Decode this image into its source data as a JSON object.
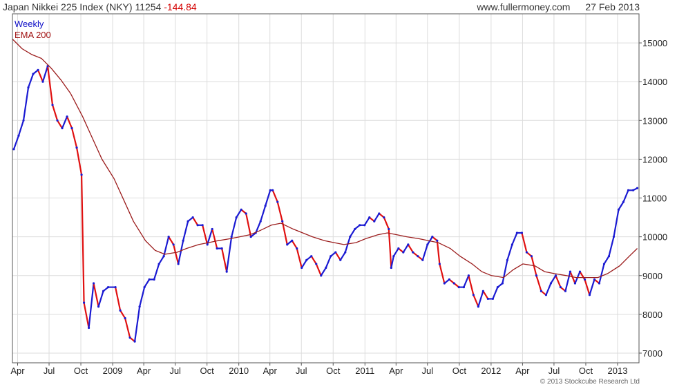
{
  "header": {
    "title": "Japan Nikkei 225 Index (NKY)",
    "last": "11254",
    "change": "-144.84",
    "source": "www.fullermoney.com",
    "date": "27 Feb 2013"
  },
  "footer": "© 2013 Stockcube Research Ltd",
  "colors": {
    "up": "#1a1ad2",
    "down": "#e01010",
    "ema": "#9b1c1c",
    "grid": "#dcdcdc",
    "axis": "#555555"
  },
  "chart_data": {
    "type": "candlestick",
    "title": "Japan Nikkei 225 Index (NKY)",
    "frequency_label": "Weekly",
    "legend": [
      "Weekly",
      "EMA 200"
    ],
    "xlabel": "",
    "ylabel": "",
    "ylim": [
      6750,
      15750
    ],
    "yticks": [
      7000,
      8000,
      9000,
      10000,
      11000,
      12000,
      13000,
      14000,
      15000
    ],
    "x_tick_labels": [
      "Apr",
      "Jul",
      "Oct",
      "2009",
      "Apr",
      "Jul",
      "Oct",
      "2010",
      "Apr",
      "Jul",
      "Oct",
      "2011",
      "Apr",
      "Jul",
      "Oct",
      "2012",
      "Apr",
      "Jul",
      "Oct",
      "2013"
    ],
    "x_tick_dates": [
      "2008-04-01",
      "2008-07-01",
      "2008-10-01",
      "2009-01-01",
      "2009-04-01",
      "2009-07-01",
      "2009-10-01",
      "2010-01-01",
      "2010-04-01",
      "2010-07-01",
      "2010-10-01",
      "2011-01-01",
      "2011-04-01",
      "2011-07-01",
      "2011-10-01",
      "2012-01-01",
      "2012-04-01",
      "2012-07-01",
      "2012-10-01",
      "2013-01-01"
    ],
    "x_range": [
      "2008-03-17",
      "2013-03-04"
    ],
    "grid": true,
    "legend_position": "top-left",
    "series": [
      {
        "name": "Weekly",
        "kind": "close-path",
        "points": [
          [
            "2008-03-21",
            12260
          ],
          [
            "2008-04-04",
            12610
          ],
          [
            "2008-04-18",
            13000
          ],
          [
            "2008-05-02",
            13850
          ],
          [
            "2008-05-16",
            14200
          ],
          [
            "2008-05-30",
            14300
          ],
          [
            "2008-06-13",
            14000
          ],
          [
            "2008-06-27",
            14400
          ],
          [
            "2008-07-11",
            13400
          ],
          [
            "2008-07-25",
            13000
          ],
          [
            "2008-08-08",
            12800
          ],
          [
            "2008-08-22",
            13100
          ],
          [
            "2008-09-05",
            12800
          ],
          [
            "2008-09-19",
            12300
          ],
          [
            "2008-10-03",
            11600
          ],
          [
            "2008-10-10",
            8300
          ],
          [
            "2008-10-24",
            7650
          ],
          [
            "2008-11-07",
            8800
          ],
          [
            "2008-11-21",
            8200
          ],
          [
            "2008-12-05",
            8600
          ],
          [
            "2008-12-19",
            8700
          ],
          [
            "2009-01-09",
            8700
          ],
          [
            "2009-01-23",
            8100
          ],
          [
            "2009-02-06",
            7900
          ],
          [
            "2009-02-20",
            7400
          ],
          [
            "2009-03-06",
            7300
          ],
          [
            "2009-03-20",
            8200
          ],
          [
            "2009-04-03",
            8700
          ],
          [
            "2009-04-17",
            8900
          ],
          [
            "2009-05-01",
            8900
          ],
          [
            "2009-05-15",
            9300
          ],
          [
            "2009-05-29",
            9500
          ],
          [
            "2009-06-12",
            10000
          ],
          [
            "2009-06-26",
            9800
          ],
          [
            "2009-07-10",
            9300
          ],
          [
            "2009-07-24",
            9900
          ],
          [
            "2009-08-07",
            10400
          ],
          [
            "2009-08-21",
            10500
          ],
          [
            "2009-09-04",
            10300
          ],
          [
            "2009-09-18",
            10300
          ],
          [
            "2009-10-02",
            9800
          ],
          [
            "2009-10-16",
            10200
          ],
          [
            "2009-10-30",
            9700
          ],
          [
            "2009-11-13",
            9700
          ],
          [
            "2009-11-27",
            9100
          ],
          [
            "2009-12-11",
            10000
          ],
          [
            "2009-12-25",
            10500
          ],
          [
            "2010-01-08",
            10700
          ],
          [
            "2010-01-22",
            10600
          ],
          [
            "2010-02-05",
            10000
          ],
          [
            "2010-02-19",
            10100
          ],
          [
            "2010-03-05",
            10400
          ],
          [
            "2010-03-19",
            10800
          ],
          [
            "2010-04-02",
            11200
          ],
          [
            "2010-04-09",
            11200
          ],
          [
            "2010-04-23",
            10900
          ],
          [
            "2010-05-07",
            10400
          ],
          [
            "2010-05-21",
            9800
          ],
          [
            "2010-06-04",
            9900
          ],
          [
            "2010-06-18",
            9700
          ],
          [
            "2010-07-02",
            9200
          ],
          [
            "2010-07-16",
            9400
          ],
          [
            "2010-07-30",
            9500
          ],
          [
            "2010-08-13",
            9300
          ],
          [
            "2010-08-27",
            9000
          ],
          [
            "2010-09-10",
            9200
          ],
          [
            "2010-09-24",
            9500
          ],
          [
            "2010-10-08",
            9600
          ],
          [
            "2010-10-22",
            9400
          ],
          [
            "2010-11-05",
            9600
          ],
          [
            "2010-11-19",
            10000
          ],
          [
            "2010-12-03",
            10200
          ],
          [
            "2010-12-17",
            10300
          ],
          [
            "2010-12-31",
            10300
          ],
          [
            "2011-01-14",
            10500
          ],
          [
            "2011-01-28",
            10400
          ],
          [
            "2011-02-11",
            10600
          ],
          [
            "2011-02-25",
            10500
          ],
          [
            "2011-03-11",
            10200
          ],
          [
            "2011-03-18",
            9200
          ],
          [
            "2011-03-25",
            9500
          ],
          [
            "2011-04-08",
            9700
          ],
          [
            "2011-04-22",
            9600
          ],
          [
            "2011-05-06",
            9800
          ],
          [
            "2011-05-20",
            9600
          ],
          [
            "2011-06-03",
            9500
          ],
          [
            "2011-06-17",
            9400
          ],
          [
            "2011-07-01",
            9800
          ],
          [
            "2011-07-15",
            10000
          ],
          [
            "2011-07-29",
            9900
          ],
          [
            "2011-08-05",
            9300
          ],
          [
            "2011-08-19",
            8800
          ],
          [
            "2011-09-02",
            8900
          ],
          [
            "2011-09-16",
            8800
          ],
          [
            "2011-09-30",
            8700
          ],
          [
            "2011-10-14",
            8700
          ],
          [
            "2011-10-28",
            9000
          ],
          [
            "2011-11-11",
            8500
          ],
          [
            "2011-11-25",
            8200
          ],
          [
            "2011-12-09",
            8600
          ],
          [
            "2011-12-23",
            8400
          ],
          [
            "2012-01-06",
            8400
          ],
          [
            "2012-01-20",
            8700
          ],
          [
            "2012-02-03",
            8800
          ],
          [
            "2012-02-17",
            9400
          ],
          [
            "2012-03-02",
            9800
          ],
          [
            "2012-03-16",
            10100
          ],
          [
            "2012-03-30",
            10100
          ],
          [
            "2012-04-13",
            9600
          ],
          [
            "2012-04-27",
            9500
          ],
          [
            "2012-05-11",
            9000
          ],
          [
            "2012-05-25",
            8600
          ],
          [
            "2012-06-08",
            8500
          ],
          [
            "2012-06-22",
            8800
          ],
          [
            "2012-07-06",
            9000
          ],
          [
            "2012-07-20",
            8700
          ],
          [
            "2012-08-03",
            8600
          ],
          [
            "2012-08-17",
            9100
          ],
          [
            "2012-08-31",
            8800
          ],
          [
            "2012-09-14",
            9100
          ],
          [
            "2012-09-28",
            8900
          ],
          [
            "2012-10-12",
            8500
          ],
          [
            "2012-10-26",
            8900
          ],
          [
            "2012-11-09",
            8800
          ],
          [
            "2012-11-23",
            9300
          ],
          [
            "2012-12-07",
            9500
          ],
          [
            "2012-12-21",
            10000
          ],
          [
            "2013-01-04",
            10700
          ],
          [
            "2013-01-18",
            10900
          ],
          [
            "2013-02-01",
            11200
          ],
          [
            "2013-02-15",
            11200
          ],
          [
            "2013-02-27",
            11254
          ]
        ]
      },
      {
        "name": "EMA 200",
        "kind": "line",
        "points": [
          [
            "2008-03-17",
            15100
          ],
          [
            "2008-04-14",
            14850
          ],
          [
            "2008-05-12",
            14700
          ],
          [
            "2008-06-09",
            14600
          ],
          [
            "2008-07-07",
            14350
          ],
          [
            "2008-08-04",
            14050
          ],
          [
            "2008-09-01",
            13700
          ],
          [
            "2008-10-06",
            13100
          ],
          [
            "2008-11-03",
            12550
          ],
          [
            "2008-12-01",
            12000
          ],
          [
            "2009-01-05",
            11500
          ],
          [
            "2009-02-02",
            10950
          ],
          [
            "2009-03-02",
            10400
          ],
          [
            "2009-04-06",
            9900
          ],
          [
            "2009-05-04",
            9650
          ],
          [
            "2009-06-01",
            9550
          ],
          [
            "2009-07-06",
            9600
          ],
          [
            "2009-08-03",
            9700
          ],
          [
            "2009-09-07",
            9800
          ],
          [
            "2009-10-05",
            9850
          ],
          [
            "2009-11-02",
            9900
          ],
          [
            "2009-12-07",
            9950
          ],
          [
            "2010-01-04",
            10000
          ],
          [
            "2010-02-01",
            10050
          ],
          [
            "2010-03-01",
            10150
          ],
          [
            "2010-04-05",
            10300
          ],
          [
            "2010-05-03",
            10350
          ],
          [
            "2010-06-07",
            10200
          ],
          [
            "2010-07-05",
            10100
          ],
          [
            "2010-08-02",
            10000
          ],
          [
            "2010-09-06",
            9900
          ],
          [
            "2010-10-04",
            9850
          ],
          [
            "2010-11-01",
            9800
          ],
          [
            "2010-12-06",
            9850
          ],
          [
            "2011-01-03",
            9950
          ],
          [
            "2011-02-07",
            10050
          ],
          [
            "2011-03-07",
            10100
          ],
          [
            "2011-04-04",
            10050
          ],
          [
            "2011-05-02",
            10000
          ],
          [
            "2011-06-06",
            9950
          ],
          [
            "2011-07-04",
            9900
          ],
          [
            "2011-08-01",
            9850
          ],
          [
            "2011-09-05",
            9700
          ],
          [
            "2011-10-03",
            9500
          ],
          [
            "2011-11-07",
            9300
          ],
          [
            "2011-12-05",
            9100
          ],
          [
            "2012-01-02",
            9000
          ],
          [
            "2012-02-06",
            8950
          ],
          [
            "2012-03-05",
            9150
          ],
          [
            "2012-04-02",
            9300
          ],
          [
            "2012-05-07",
            9250
          ],
          [
            "2012-06-04",
            9100
          ],
          [
            "2012-07-02",
            9050
          ],
          [
            "2012-08-06",
            9000
          ],
          [
            "2012-09-03",
            8950
          ],
          [
            "2012-10-01",
            8950
          ],
          [
            "2012-11-05",
            8950
          ],
          [
            "2012-12-03",
            9050
          ],
          [
            "2013-01-07",
            9250
          ],
          [
            "2013-02-04",
            9500
          ],
          [
            "2013-02-27",
            9700
          ]
        ]
      }
    ]
  }
}
